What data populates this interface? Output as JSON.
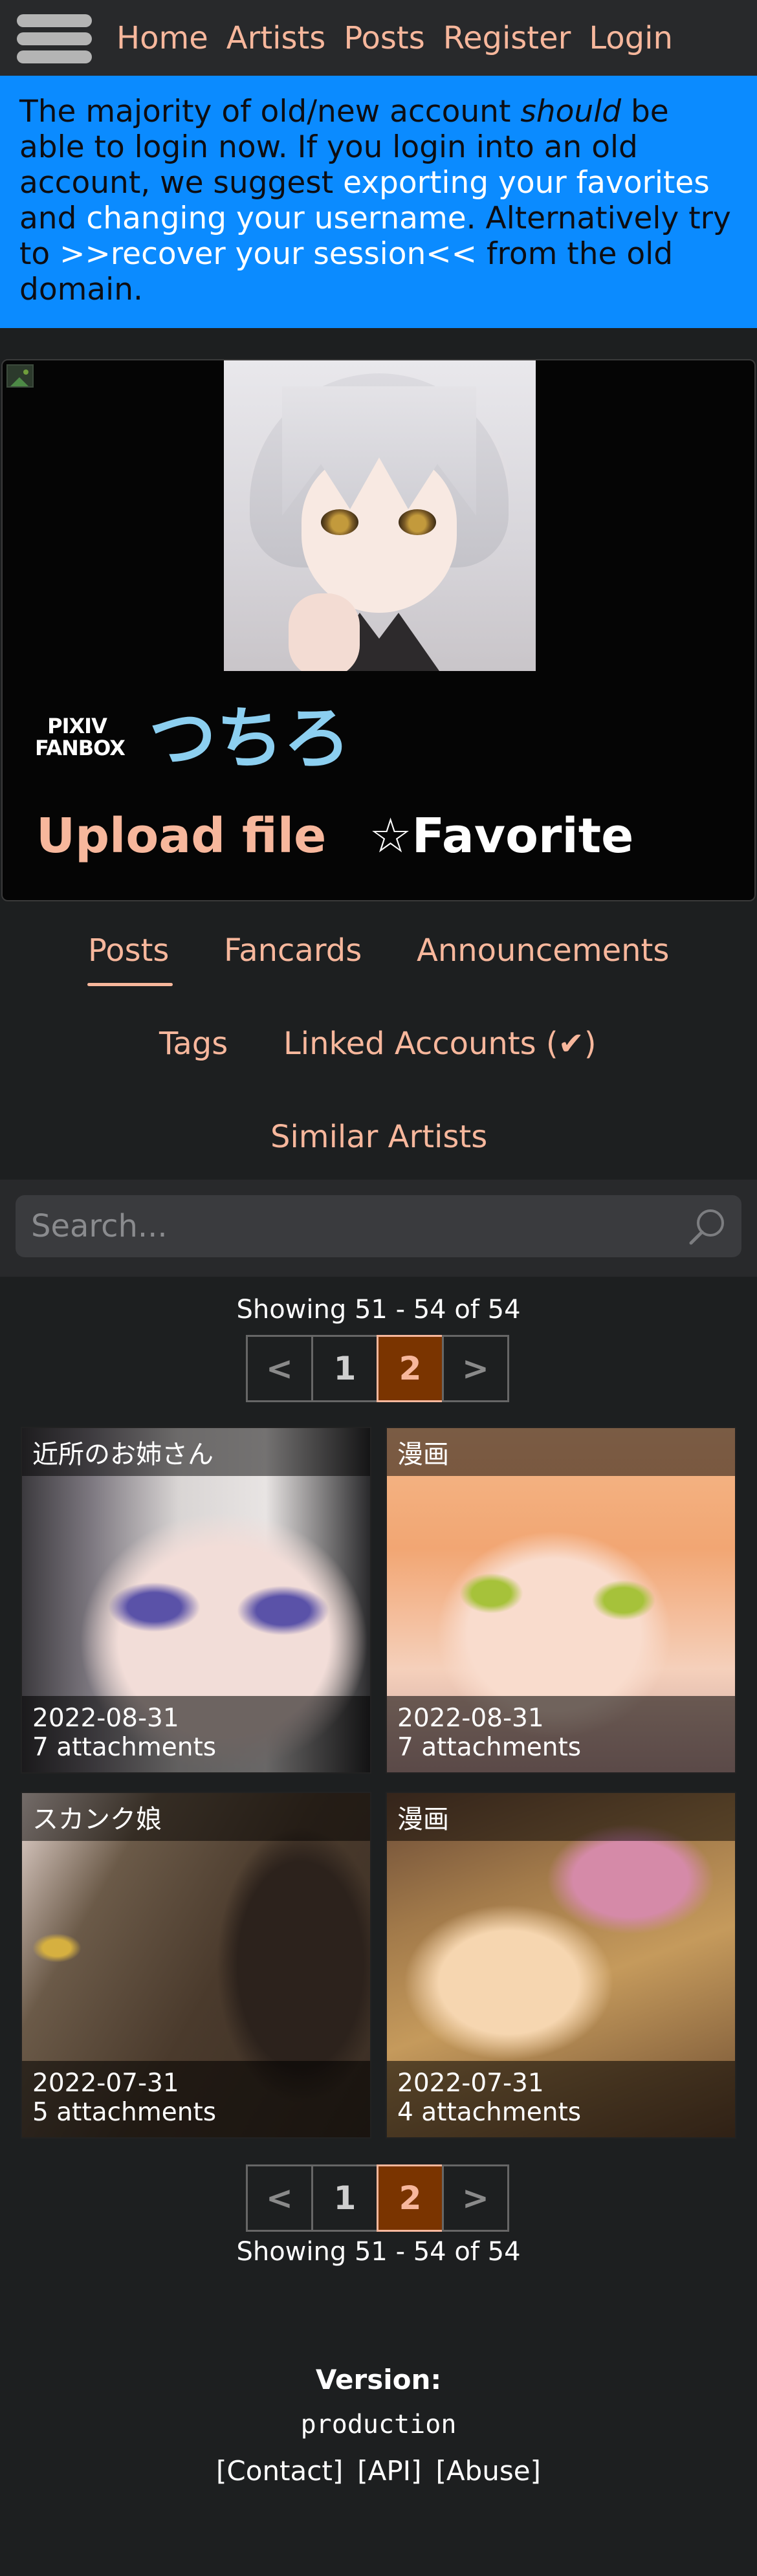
{
  "nav": {
    "menu_icon": "hamburger-menu-icon",
    "links": [
      "Home",
      "Artists",
      "Posts",
      "Register",
      "Login"
    ]
  },
  "banner": {
    "text_1": "The majority of old/new account ",
    "text_em": "should",
    "text_2": " be able to login now. If you login into an old account, we suggest ",
    "link_export": "exporting your favorites",
    "text_3": " and ",
    "link_username": "changing your username",
    "text_4": ". Alternatively try to ",
    "link_recover": ">>recover your session<<",
    "text_5": " from the old domain."
  },
  "artist": {
    "service_logo_line1": "PIXIV",
    "service_logo_line2": "FANBOX",
    "name": "つちろ",
    "upload_label": "Upload file",
    "favorite_label": "☆Favorite"
  },
  "tabs": [
    "Posts",
    "Fancards",
    "Announcements",
    "Tags",
    "Linked Accounts (✔)",
    "Similar Artists"
  ],
  "search": {
    "placeholder": "Search...",
    "icon": "search-icon"
  },
  "pagination": {
    "showing": "Showing 51 - 54 of 54",
    "prev": "<",
    "pages": [
      "1",
      "2"
    ],
    "current": "2",
    "next": ">"
  },
  "posts": [
    {
      "title": "近所のお姉さん",
      "date": "2022-08-31",
      "attachments": "7 attachments"
    },
    {
      "title": "漫画",
      "date": "2022-08-31",
      "attachments": "7 attachments"
    },
    {
      "title": "スカンク娘",
      "date": "2022-07-31",
      "attachments": "5 attachments"
    },
    {
      "title": "漫画",
      "date": "2022-07-31",
      "attachments": "4 attachments"
    }
  ],
  "footer": {
    "version_label": "Version:",
    "version_value": "production",
    "links": [
      "[Contact]",
      "[API]",
      "[Abuse]"
    ]
  },
  "colors": {
    "accent": "#f7b79c",
    "banner": "#0b8bff",
    "artist_name": "#8ccff0",
    "page_bg": "#1d1f20"
  }
}
